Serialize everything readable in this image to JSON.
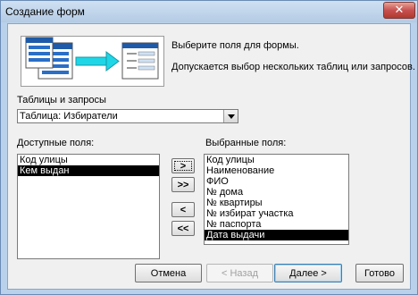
{
  "window": {
    "title": "Создание форм",
    "close_glyph": "✕"
  },
  "intro": {
    "line1": "Выберите поля для формы.",
    "line2": "Допускается выбор нескольких таблиц или запросов."
  },
  "source": {
    "label": "Таблицы и запросы",
    "selected": "Таблица: Избиратели",
    "arrow_icon": "chevron-down-icon"
  },
  "available": {
    "label": "Доступные поля:",
    "items": [
      {
        "text": "Код улицы",
        "selected": false
      },
      {
        "text": "Кем выдан",
        "selected": true
      }
    ]
  },
  "chosen": {
    "label": "Выбранные поля:",
    "items": [
      {
        "text": "Код улицы",
        "selected": false
      },
      {
        "text": "Наименование",
        "selected": false
      },
      {
        "text": "ФИО",
        "selected": false
      },
      {
        "text": "№ дома",
        "selected": false
      },
      {
        "text": "№ квартиры",
        "selected": false
      },
      {
        "text": "№ избират участка",
        "selected": false
      },
      {
        "text": "№ паспорта",
        "selected": false
      },
      {
        "text": "Дата выдачи",
        "selected": true
      }
    ]
  },
  "move_buttons": {
    "add_one": ">",
    "add_all": ">>",
    "remove_one": "<",
    "remove_all": "<<"
  },
  "footer": {
    "cancel": "Отмена",
    "back": "< Назад",
    "next": "Далее >",
    "finish": "Готово"
  }
}
